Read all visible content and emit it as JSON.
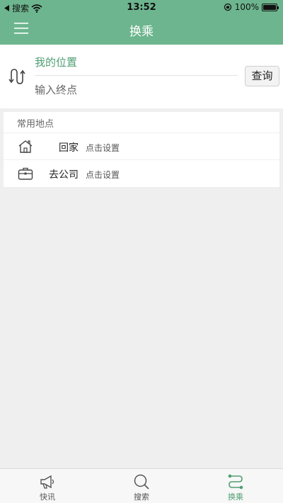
{
  "status_bar": {
    "back_app": "搜索",
    "time": "13:52",
    "battery": "100%"
  },
  "header": {
    "title": "换乘"
  },
  "route": {
    "from": "我的位置",
    "to_placeholder": "输入终点",
    "query_label": "查询"
  },
  "places": {
    "title": "常用地点",
    "items": [
      {
        "name": "回家",
        "hint": "点击设置",
        "icon": "home-icon"
      },
      {
        "name": "去公司",
        "hint": "点击设置",
        "icon": "briefcase-icon"
      }
    ]
  },
  "tabs": [
    {
      "label": "快讯",
      "icon": "megaphone-icon",
      "active": false
    },
    {
      "label": "搜索",
      "icon": "search-icon",
      "active": false
    },
    {
      "label": "换乘",
      "icon": "route-icon",
      "active": true
    }
  ],
  "colors": {
    "brand": "#6db58e",
    "accent_text": "#4f9e73",
    "background": "#efefef"
  }
}
